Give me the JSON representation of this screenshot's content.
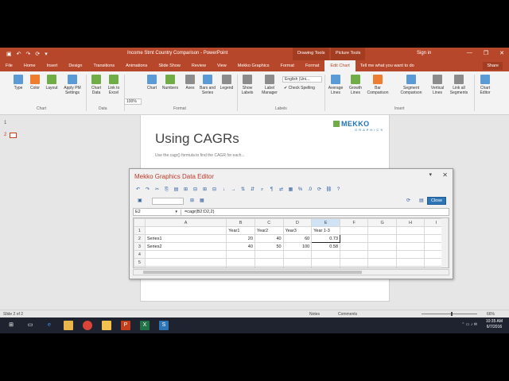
{
  "window": {
    "title": "Income Stmt Country Comparison - PowerPoint",
    "qat_icons": [
      "save-icon",
      "undo-icon",
      "redo-icon",
      "repeat-icon",
      "customize-icon"
    ],
    "ctx_drawing": "Drawing Tools",
    "ctx_picture": "Picture Tools",
    "signin": "Sign in",
    "controls": [
      "—",
      "❐",
      "✕"
    ]
  },
  "tabs": [
    "File",
    "Home",
    "Insert",
    "Design",
    "Transitions",
    "Animations",
    "Slide Show",
    "Review",
    "View",
    "Mekko Graphics",
    "Format",
    "Format",
    "Edit Chart"
  ],
  "tell_me": "Tell me what you want to do",
  "share": "Share",
  "ribbon": {
    "buttons": [
      "Type",
      "Color",
      "Layout",
      "Apply PM Settings",
      "Chart Data",
      "Link to Excel",
      "Chart",
      "Numbers",
      "Axes",
      "Bars and Series",
      "Legend",
      "Show Labels",
      "Label Manager",
      "Average Lines",
      "Growth Lines",
      "Bar Comparison",
      "Segment Comparison",
      "Vertical Lines",
      "Link all Segments",
      "Chart Editor"
    ],
    "groups": [
      "Chart",
      "Data",
      "Format",
      "Labels",
      "Insert"
    ],
    "zoom_value": "100%",
    "language": "English (Uni...",
    "check_spelling": "Check Spelling"
  },
  "slides": {
    "n1": "1",
    "n2": "2"
  },
  "slide": {
    "heading": "Using CAGRs",
    "logo_line1": "MEKKO",
    "logo_line2": "GRAPHICS",
    "subtext": "Use the cagr() formula to find the CAGR for each..."
  },
  "editor": {
    "title": "Mekko Graphics Data Editor",
    "close_label": "Close",
    "cell_ref": "E2",
    "formula": "=cagr(B2:D2,2)",
    "columns": [
      "",
      "A",
      "B",
      "C",
      "D",
      "E",
      "F",
      "G",
      "H",
      "I"
    ],
    "rows": [
      [
        "1",
        "",
        "Year1",
        "Year2",
        "Year3",
        "Year 1-3",
        "",
        "",
        "",
        ""
      ],
      [
        "2",
        "Series1",
        "20",
        "40",
        "60",
        "0.73",
        "",
        "",
        "",
        ""
      ],
      [
        "3",
        "Series2",
        "40",
        "50",
        "100",
        "0.58",
        "",
        "",
        "",
        ""
      ],
      [
        "4",
        "",
        "",
        "",
        "",
        "",
        "",
        "",
        "",
        ""
      ],
      [
        "5",
        "",
        "",
        "",
        "",
        "",
        "",
        "",
        "",
        ""
      ],
      [
        "6",
        "",
        "",
        "",
        "",
        "",
        "",
        "",
        "",
        ""
      ]
    ]
  },
  "status": {
    "slide_of": "Slide 2 of 2",
    "notes": "Notes",
    "comments": "Comments",
    "zoom": "66%"
  },
  "taskbar": {
    "time": "10:35 AM",
    "date": "6/7/2016"
  }
}
